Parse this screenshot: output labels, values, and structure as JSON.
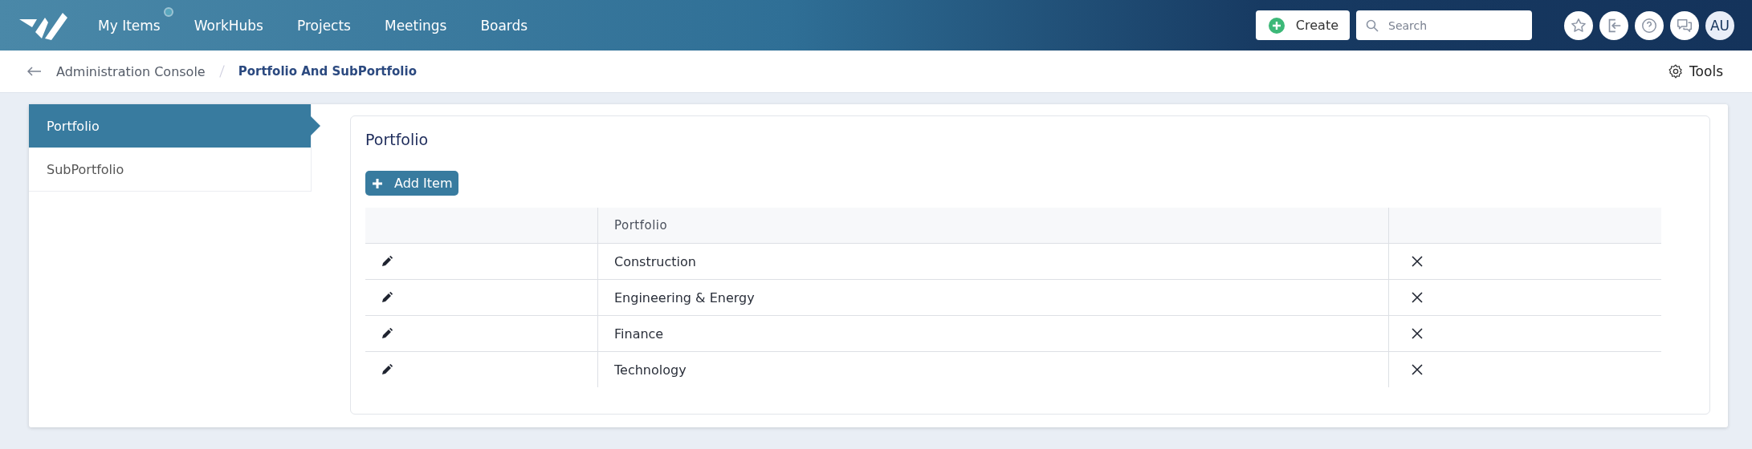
{
  "nav": {
    "items": [
      {
        "label": "My Items",
        "indicator": true
      },
      {
        "label": "WorkHubs",
        "indicator": false
      },
      {
        "label": "Projects",
        "indicator": false
      },
      {
        "label": "Meetings",
        "indicator": false
      },
      {
        "label": "Boards",
        "indicator": false
      }
    ],
    "create": "Create",
    "search": {
      "placeholder": "Search"
    },
    "avatar": "AU"
  },
  "breadcrumb": {
    "parent": "Administration Console",
    "current": "Portfolio And SubPortfolio"
  },
  "tools": "Tools",
  "sidebar": {
    "items": [
      {
        "label": "Portfolio",
        "selected": true
      },
      {
        "label": "SubPortfolio",
        "selected": false
      }
    ]
  },
  "panel": {
    "title": "Portfolio",
    "add_button": "Add Item"
  },
  "table": {
    "column": "Portfolio",
    "rows": [
      "Construction",
      "Engineering & Energy",
      "Finance",
      "Technology"
    ]
  }
}
